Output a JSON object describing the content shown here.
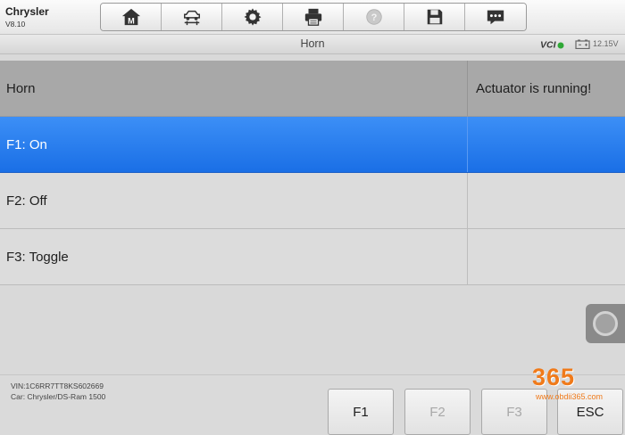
{
  "app": {
    "name": "Chrysler",
    "version": "V8.10"
  },
  "toolbar": {
    "buttons": [
      {
        "icon": "home-m-icon",
        "label": "M"
      },
      {
        "icon": "vehicle-lift-icon"
      },
      {
        "icon": "gear-icon"
      },
      {
        "icon": "printer-icon"
      },
      {
        "icon": "help-icon",
        "label": "?"
      },
      {
        "icon": "save-icon"
      },
      {
        "icon": "message-icon"
      }
    ]
  },
  "titlebar": {
    "title": "Horn",
    "vci_label": "VCI",
    "voltage": "12.15V"
  },
  "table": {
    "header": {
      "name": "Horn",
      "status": "Actuator is running!"
    },
    "rows": [
      {
        "label": "F1: On",
        "value": "",
        "selected": true
      },
      {
        "label": "F2: Off",
        "value": "",
        "selected": false
      },
      {
        "label": "F3: Toggle",
        "value": "",
        "selected": false
      }
    ]
  },
  "footer": {
    "vin": "VIN:1C6RR7TT8KS602669",
    "car": "Car: Chrysler/DS-Ram 1500",
    "buttons": [
      {
        "label": "F1",
        "enabled": true
      },
      {
        "label": "F2",
        "enabled": false
      },
      {
        "label": "F3",
        "enabled": false
      },
      {
        "label": "ESC",
        "enabled": true
      }
    ]
  },
  "watermark": {
    "digits": "365",
    "url": "www.obdii365.com"
  },
  "colors": {
    "selected_row": "#2a7ff0",
    "header_row": "#a8a8a8",
    "watermark": "#f07a1a"
  }
}
